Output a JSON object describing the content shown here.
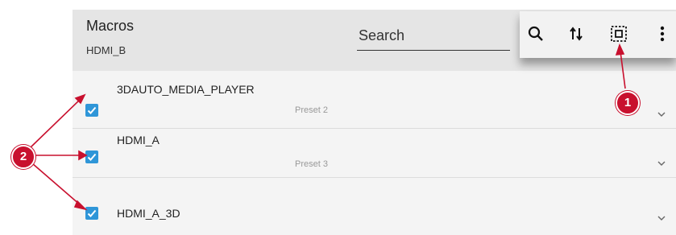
{
  "header": {
    "title": "Macros",
    "subtitle": "HDMI_B"
  },
  "search": {
    "placeholder": "Search"
  },
  "toolbar": {
    "icons": [
      "search-icon",
      "sort-icon",
      "select-all-icon",
      "more-vert-icon"
    ]
  },
  "rows": [
    {
      "name": "3DAUTO_MEDIA_PLAYER",
      "preset": "Preset 2",
      "checked": true
    },
    {
      "name": "HDMI_A",
      "preset": "Preset 3",
      "checked": true
    },
    {
      "name": "HDMI_A_3D",
      "preset": "",
      "checked": true
    }
  ],
  "callouts": {
    "one": "1",
    "two": "2"
  },
  "colors": {
    "accent": "#2f96d8",
    "callout": "#c8102e",
    "header": "#e5e5e5"
  }
}
